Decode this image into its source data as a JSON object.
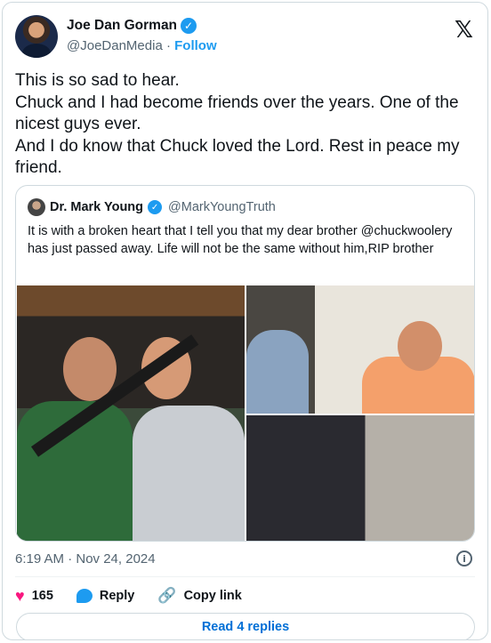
{
  "author": {
    "display_name": "Joe Dan Gorman",
    "handle": "@JoeDanMedia",
    "separator": "·",
    "follow_label": "Follow",
    "verified": true
  },
  "platform_logo": "x-logo",
  "tweet": {
    "lines": [
      "This is so sad to hear.",
      "Chuck and I had become friends over the years. One of the nicest guys ever.",
      "And I do know that Chuck loved the Lord.  Rest in peace my friend."
    ]
  },
  "quote": {
    "display_name": "Dr. Mark Young",
    "handle": "@MarkYoungTruth",
    "verified": true,
    "text": "It is with a broken heart that I tell you that my dear brother @chuckwoolery  has just passed away. Life will not be the same without him,RIP brother",
    "media_count": 3
  },
  "meta": {
    "timestamp": "6:19 AM · Nov 24, 2024"
  },
  "actions": {
    "like_count": "165",
    "reply_label": "Reply",
    "copy_link_label": "Copy link"
  },
  "read_replies_label": "Read 4 replies",
  "colors": {
    "accent": "#1d9bf0",
    "like": "#f91880",
    "muted": "#536471"
  }
}
